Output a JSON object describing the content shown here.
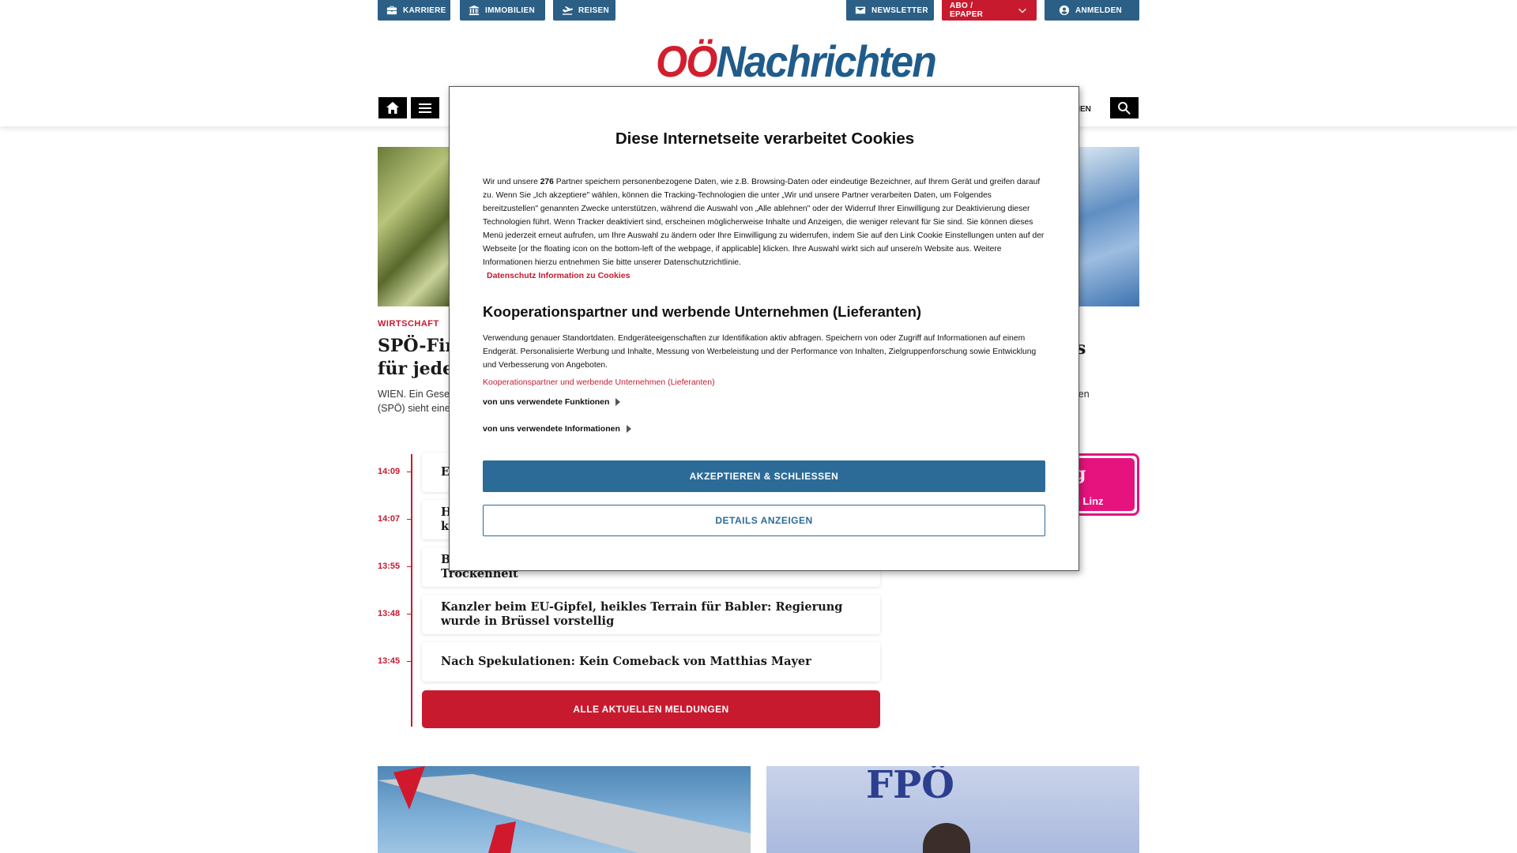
{
  "topbar": {
    "left": [
      {
        "label": "KARRIERE",
        "icon": "briefcase-icon"
      },
      {
        "label": "IMMOBILIEN",
        "icon": "bank-icon"
      },
      {
        "label": "REISEN",
        "icon": "plane-icon"
      }
    ],
    "right": [
      {
        "label": "NEWSLETTER",
        "icon": "mail-icon"
      },
      {
        "label": "ABO / EPAPER",
        "icon": "chevron-down-icon"
      },
      {
        "label": "ANMELDEN",
        "icon": "user-icon"
      }
    ]
  },
  "header": {
    "logo_part1": "OÖ",
    "logo_part2": "Nachrichten",
    "nav_fragment": "ONEN"
  },
  "article": {
    "kicker": "WIRTSCHAFT",
    "headline_line1": "SPÖ-Fir",
    "headline_line2": "für jede",
    "teaser_line1": "WIEN. Ein Gese",
    "teaser_line2": "(SPÖ) sieht eine"
  },
  "right_article": {
    "fragment_headline": "s",
    "fragment_teaser": "len"
  },
  "promo": {
    "big_letter": "g",
    "text": "n Linz"
  },
  "timeline": {
    "items": [
      {
        "time": "14:09",
        "title": "E"
      },
      {
        "time": "14:07",
        "title": "H\nk"
      },
      {
        "time": "13:55",
        "title": "B\nTrockenheit"
      },
      {
        "time": "13:48",
        "title": "Kanzler beim EU-Gipfel, heikles Terrain für Babler: Regierung wurde in Brüssel vorstellig"
      },
      {
        "time": "13:45",
        "title": "Nach Spekulationen: Kein Comeback von Matthias Mayer"
      }
    ],
    "all_button": "ALLE AKTUELLEN MELDUNGEN"
  },
  "bottom_images": {
    "right_logo_text": "FPÖ"
  },
  "cookie_modal": {
    "title": "Diese Internetseite verarbeitet Cookies",
    "body_before_count": "Wir und unsere ",
    "partner_count": "276",
    "body_after_count": " Partner speichern personenbezogene Daten, wie z.B. Browsing-Daten oder eindeutige Bezeichner, auf Ihrem Gerät und greifen darauf zu. Wenn Sie „Ich akzeptiere\" wählen, können die Tracking-Technologien die unter „Wir und unsere Partner verarbeiten Daten, um Folgendes bereitzustellen\" genannten Zwecke unterstützen, während die Auswahl von „Alle ablehnen\" oder der Widerruf Ihrer Einwilligung zur Deaktivierung dieser Technologien führt. Wenn Tracker deaktiviert sind, erscheinen möglicherweise Inhalte und Anzeigen, die weniger relevant für Sie sind. Sie können dieses Menü jederzeit erneut aufrufen, um Ihre Auswahl zu ändern oder Ihre Einwilligung zu widerrufen, indem Sie auf den Link Cookie Einstellungen unten auf der Webseite [or the floating icon on the bottom-left of the webpage, if applicable] klicken. Ihre Auswahl wirkt sich auf unsere/n Website aus. Weitere Informationen hierzu entnehmen Sie bitte unserer Datenschutzrichtlinie.",
    "privacy_link": "Datenschutz Information zu Cookies",
    "section_title": "Kooperationspartner und werbende Unternehmen (Lieferanten)",
    "section_body": "Verwendung genauer Standortdaten. Endgeräteeigenschaften zur Identifikation aktiv abfragen. Speichern von oder Zugriff auf Informationen auf einem Endgerät. Personalisierte Werbung und Inhalte, Messung von Werbeleistung und der Performance von Inhalten, Zielgruppenforschung sowie Entwicklung und Verbesserung von Angeboten.",
    "section_link": "Kooperationspartner und werbende Unternehmen (Lieferanten)",
    "expand1": "von uns verwendete Funktionen",
    "expand2": "von uns verwendete Informationen",
    "accept_button": "AKZEPTIEREN & SCHLIESSEN",
    "details_button": "DETAILS ANZEIGEN"
  },
  "colors": {
    "brand_blue": "#2b5f86",
    "brand_red": "#c81a2f",
    "accept_blue": "#2c6b98",
    "promo_pink": "#e6127e"
  }
}
